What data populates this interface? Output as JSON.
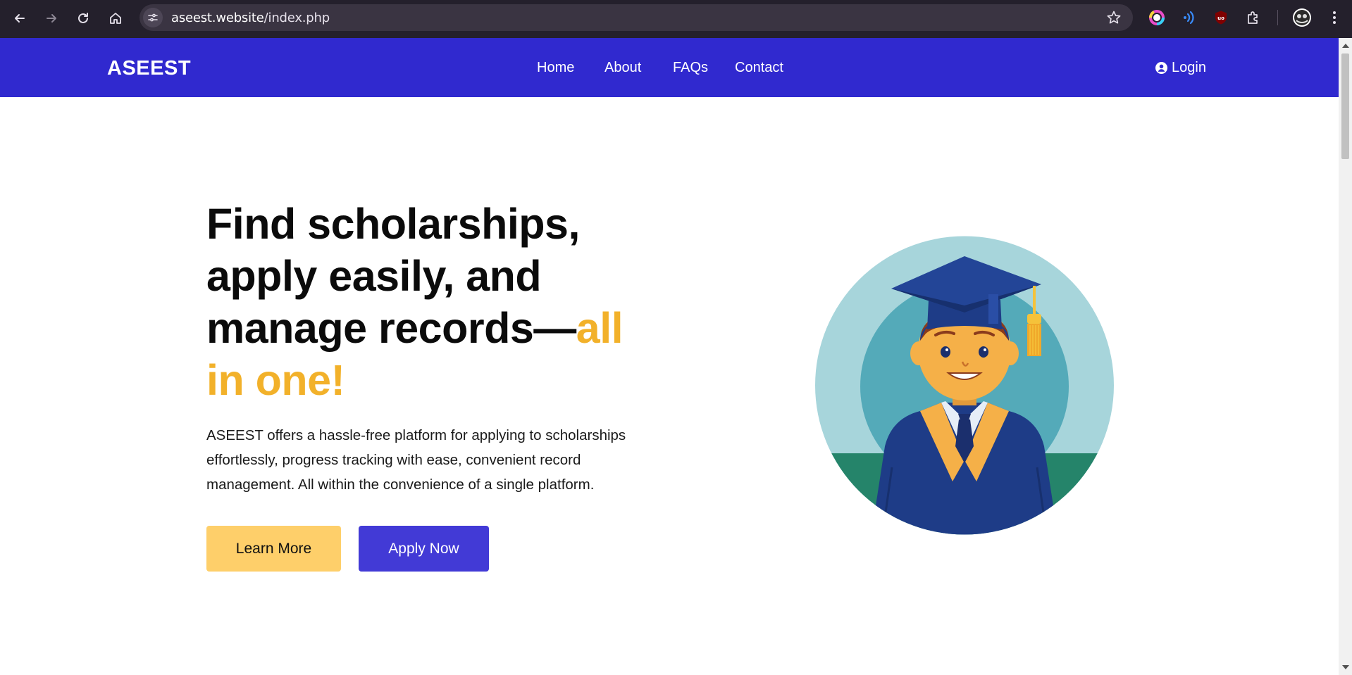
{
  "browser": {
    "url_host": "aseest.website",
    "url_path": "/index.php",
    "icons": [
      "back-icon",
      "forward-icon",
      "reload-icon",
      "home-icon",
      "site-info-icon",
      "bookmark-star-icon",
      "color-extension-icon",
      "audio-extension-icon",
      "ublock-extension-icon",
      "extensions-puzzle-icon",
      "profile-avatar-icon",
      "menu-kebab-icon"
    ]
  },
  "header": {
    "brand": "ASEEST",
    "nav": [
      "Home",
      "About",
      "FAQs",
      "Contact"
    ],
    "login_label": "Login",
    "background": "#3029cf"
  },
  "hero": {
    "headline_main": "Find scholarships, apply easily, and manage records—",
    "headline_accent": "all in one!",
    "accent_color": "#f2b12a",
    "description": "ASEEST offers a hassle-free platform for applying to scholarships effortlessly, progress tracking with ease, convenient record management. All within the convenience of a single platform.",
    "learn_more_label": "Learn More",
    "apply_now_label": "Apply Now",
    "image_subject": "graduate-illustration"
  }
}
